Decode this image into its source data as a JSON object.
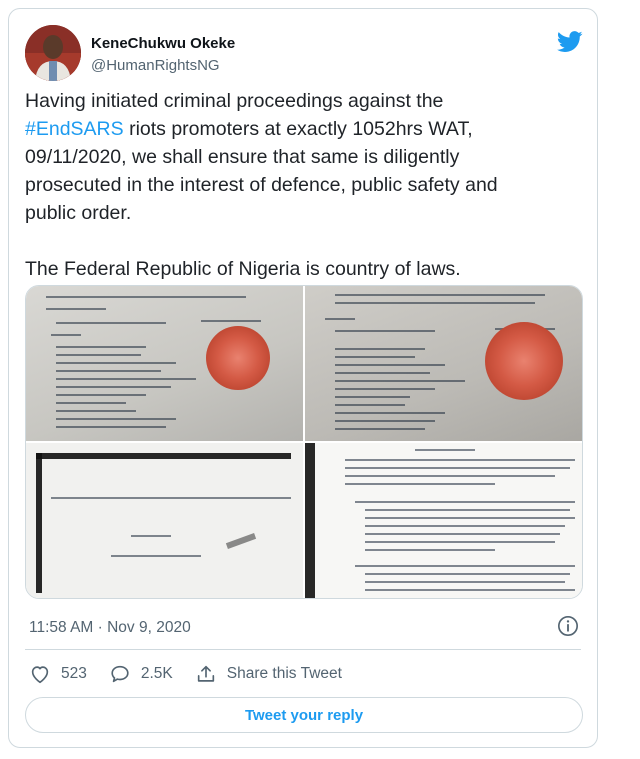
{
  "author": {
    "name": "KeneChukwu Okeke",
    "handle": "@HumanRightsNG"
  },
  "tweet": {
    "text_part1": "Having initiated criminal proceedings against the\n",
    "hashtag": "#EndSARS",
    "text_part2": " riots promoters at exactly 1052hrs WAT,\n09/11/2020, we shall ensure that same is diligently\nprosecuted in the interest of defence, public safety and\npublic order.\n\nThe Federal Republic of Nigeria is country of laws."
  },
  "meta": {
    "timestamp": "11:58 AM · Nov 9, 2020"
  },
  "actions": {
    "likes": "523",
    "replies": "2.5K",
    "share_label": "Share this Tweet"
  },
  "reply_button": {
    "label": "Tweet your reply"
  },
  "colors": {
    "accent": "#1d9bf0",
    "secondary_text": "#536471",
    "border": "#cfd9de"
  },
  "icons": [
    "twitter-bird-icon",
    "info-icon",
    "heart-icon",
    "reply-bubble-icon",
    "share-icon"
  ]
}
